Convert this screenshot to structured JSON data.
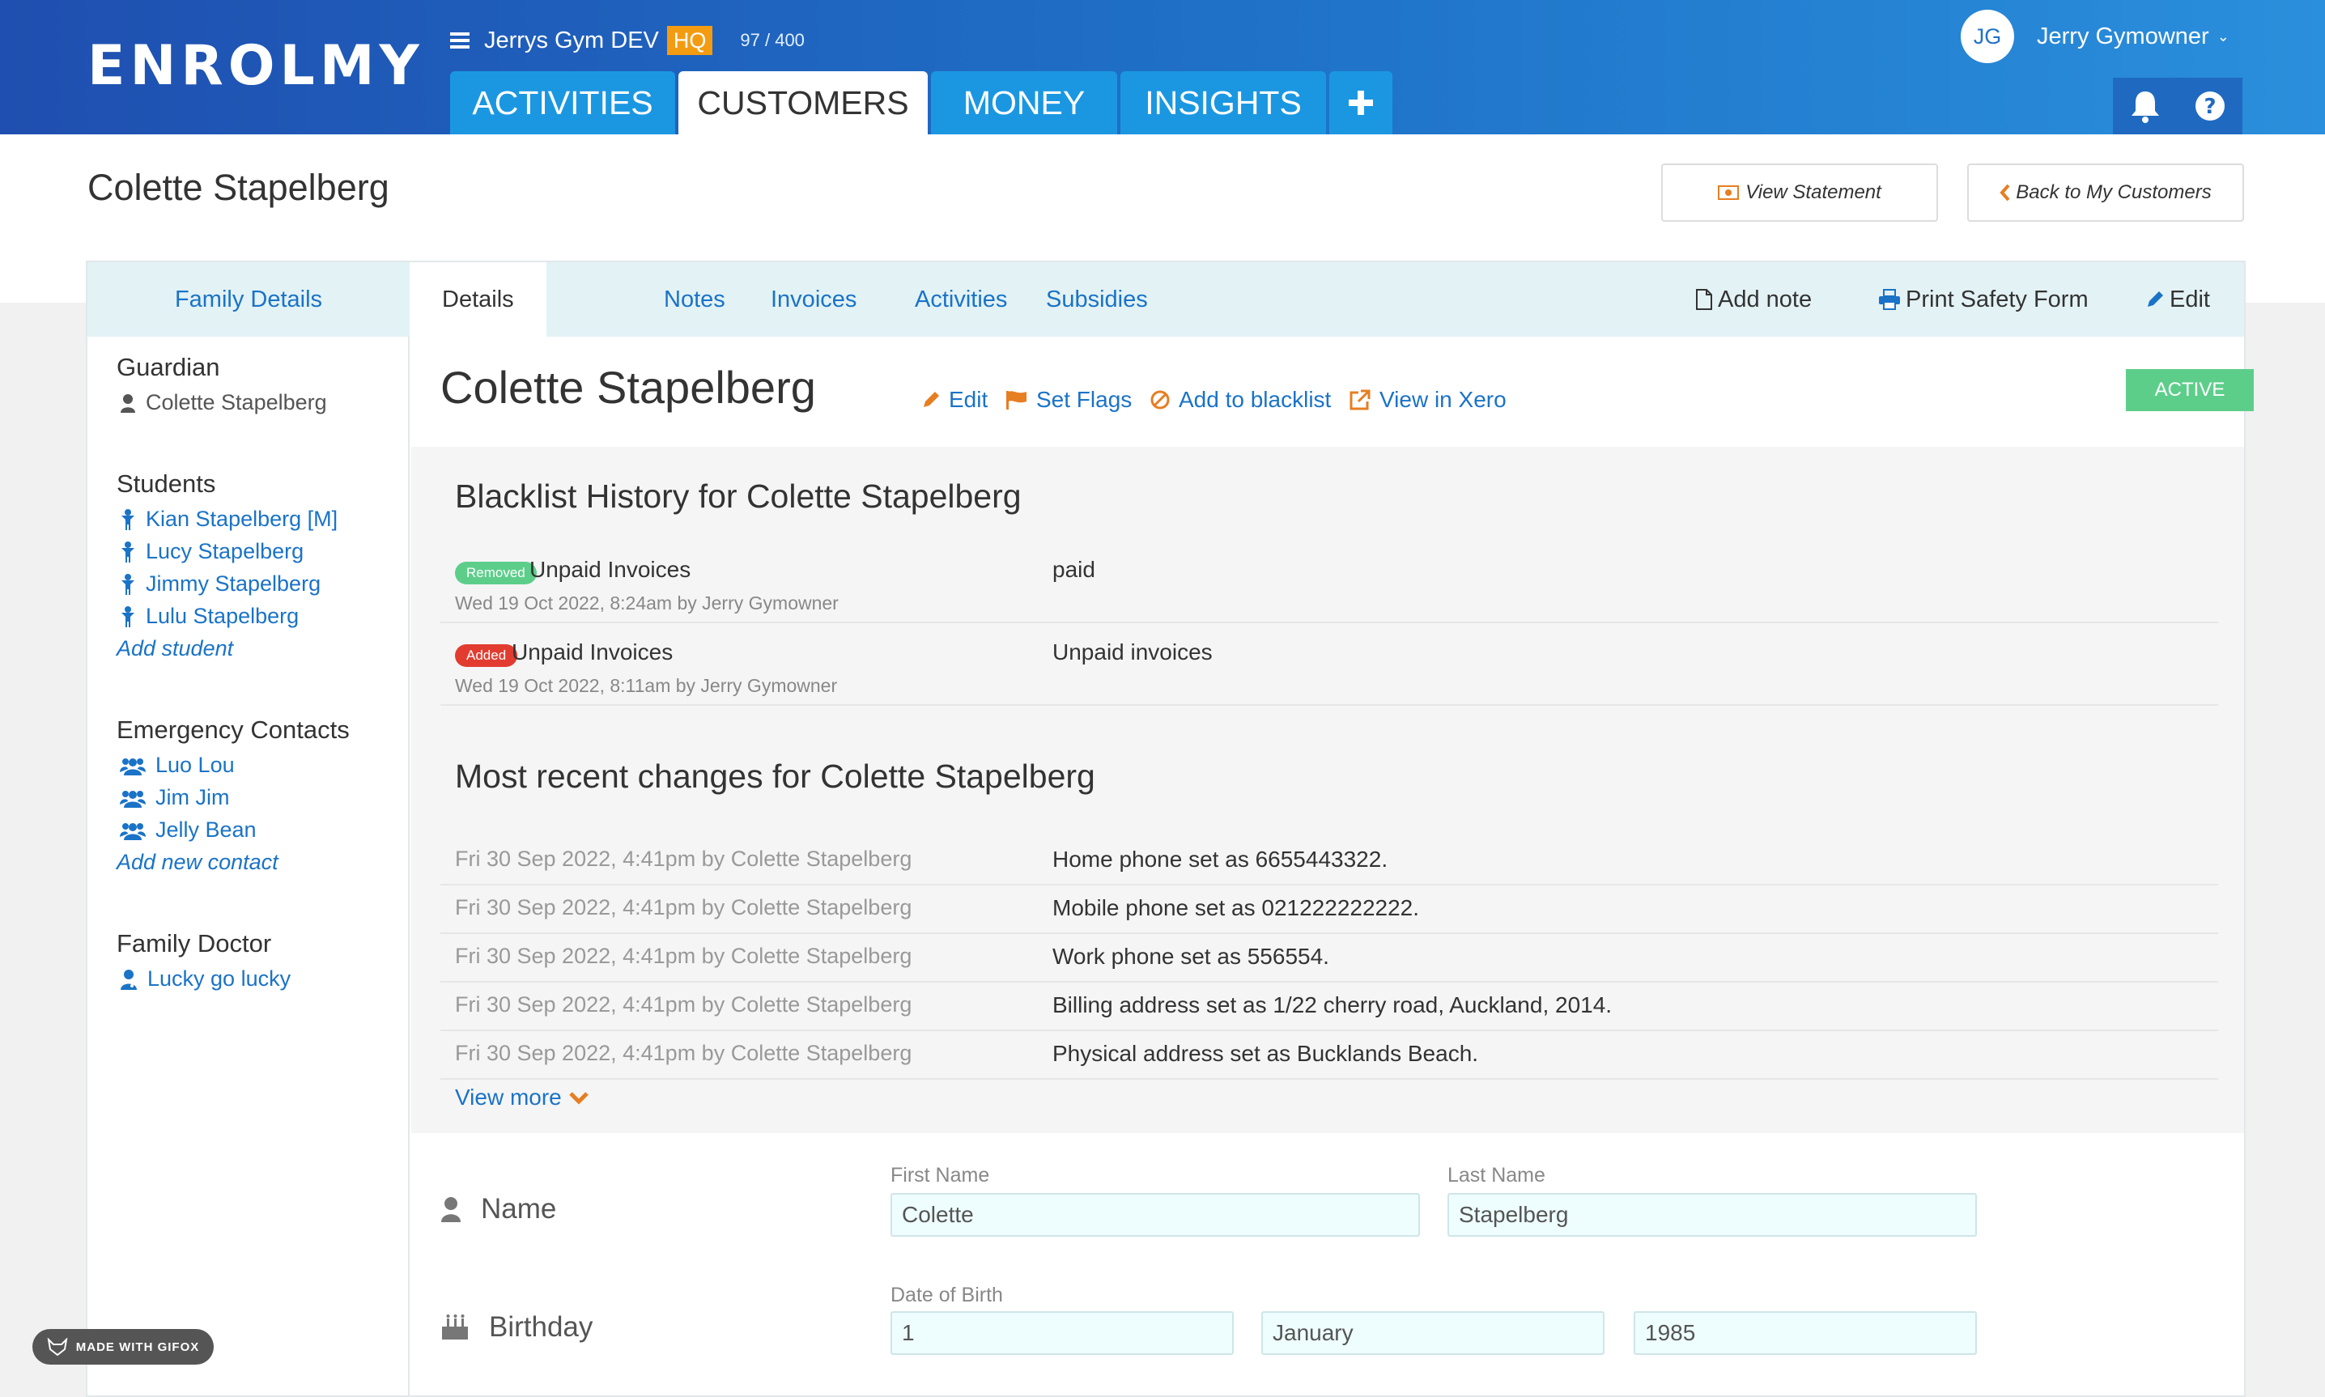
{
  "app": {
    "logo": "ENROLMY",
    "org_name": "Jerrys Gym DEV",
    "org_badge": "HQ",
    "usage": "97 / 400",
    "user_initials": "JG",
    "user_name": "Jerry Gymowner",
    "colors": {
      "accent": "#1a73c7",
      "nav": "#1b97e2",
      "warning": "#f39c12",
      "success": "#5dce8a",
      "danger": "#e23c30"
    }
  },
  "nav": {
    "tabs": [
      {
        "label": "ACTIVITIES",
        "active": false
      },
      {
        "label": "CUSTOMERS",
        "active": true
      },
      {
        "label": "MONEY",
        "active": false
      },
      {
        "label": "INSIGHTS",
        "active": false
      }
    ],
    "add_icon": "plus-icon",
    "icons": [
      "bell-icon",
      "help-icon"
    ]
  },
  "header": {
    "title": "Colette Stapelberg",
    "view_statement": "View Statement",
    "back": "Back to My Customers"
  },
  "card_tabs": {
    "family": "Family Details",
    "tabs": [
      "Details",
      "Notes",
      "Invoices",
      "Activities",
      "Subsidies"
    ],
    "active": "Details",
    "actions": {
      "add_note": "Add note",
      "print": "Print Safety Form",
      "edit": "Edit"
    }
  },
  "sidebar": {
    "guardian_heading": "Guardian",
    "guardian": "Colette Stapelberg",
    "students_heading": "Students",
    "students": [
      "Kian Stapelberg [M]",
      "Lucy Stapelberg",
      "Jimmy Stapelberg",
      "Lulu Stapelberg"
    ],
    "add_student": "Add student",
    "emergency_heading": "Emergency Contacts",
    "contacts": [
      "Luo Lou",
      "Jim Jim",
      "Jelly Bean"
    ],
    "add_contact": "Add new contact",
    "doctor_heading": "Family Doctor",
    "doctor": "Lucky go lucky"
  },
  "customer": {
    "name": "Colette Stapelberg",
    "actions": {
      "edit": "Edit",
      "flags": "Set Flags",
      "blacklist": "Add to blacklist",
      "xero": "View in Xero"
    },
    "status": "ACTIVE"
  },
  "blacklist": {
    "title": "Blacklist History for Colette Stapelberg",
    "items": [
      {
        "badge": "Removed",
        "reason": "Unpaid Invoices",
        "meta": "Wed 19 Oct 2022, 8:24am by Jerry Gymowner",
        "note": "paid"
      },
      {
        "badge": "Added",
        "reason": "Unpaid Invoices",
        "meta": "Wed 19 Oct 2022, 8:11am by Jerry Gymowner",
        "note": "Unpaid invoices"
      }
    ]
  },
  "changes": {
    "title": "Most recent changes for Colette Stapelberg",
    "items": [
      {
        "meta": "Fri 30 Sep 2022, 4:41pm by Colette Stapelberg",
        "desc": "Home phone set as 6655443322."
      },
      {
        "meta": "Fri 30 Sep 2022, 4:41pm by Colette Stapelberg",
        "desc": "Mobile phone set as 021222222222."
      },
      {
        "meta": "Fri 30 Sep 2022, 4:41pm by Colette Stapelberg",
        "desc": "Work phone set as 556554."
      },
      {
        "meta": "Fri 30 Sep 2022, 4:41pm by Colette Stapelberg",
        "desc": "Billing address set as 1/22 cherry road, Auckland, 2014."
      },
      {
        "meta": "Fri 30 Sep 2022, 4:41pm by Colette Stapelberg",
        "desc": "Physical address set as Bucklands Beach."
      }
    ],
    "view_more": "View more"
  },
  "form": {
    "name_label": "Name",
    "first_name_label": "First Name",
    "first_name": "Colette",
    "last_name_label": "Last Name",
    "last_name": "Stapelberg",
    "birthday_label": "Birthday",
    "dob_label": "Date of Birth",
    "dob_day": "1",
    "dob_month": "January",
    "dob_year": "1985"
  },
  "watermark": "MADE WITH GIFOX"
}
